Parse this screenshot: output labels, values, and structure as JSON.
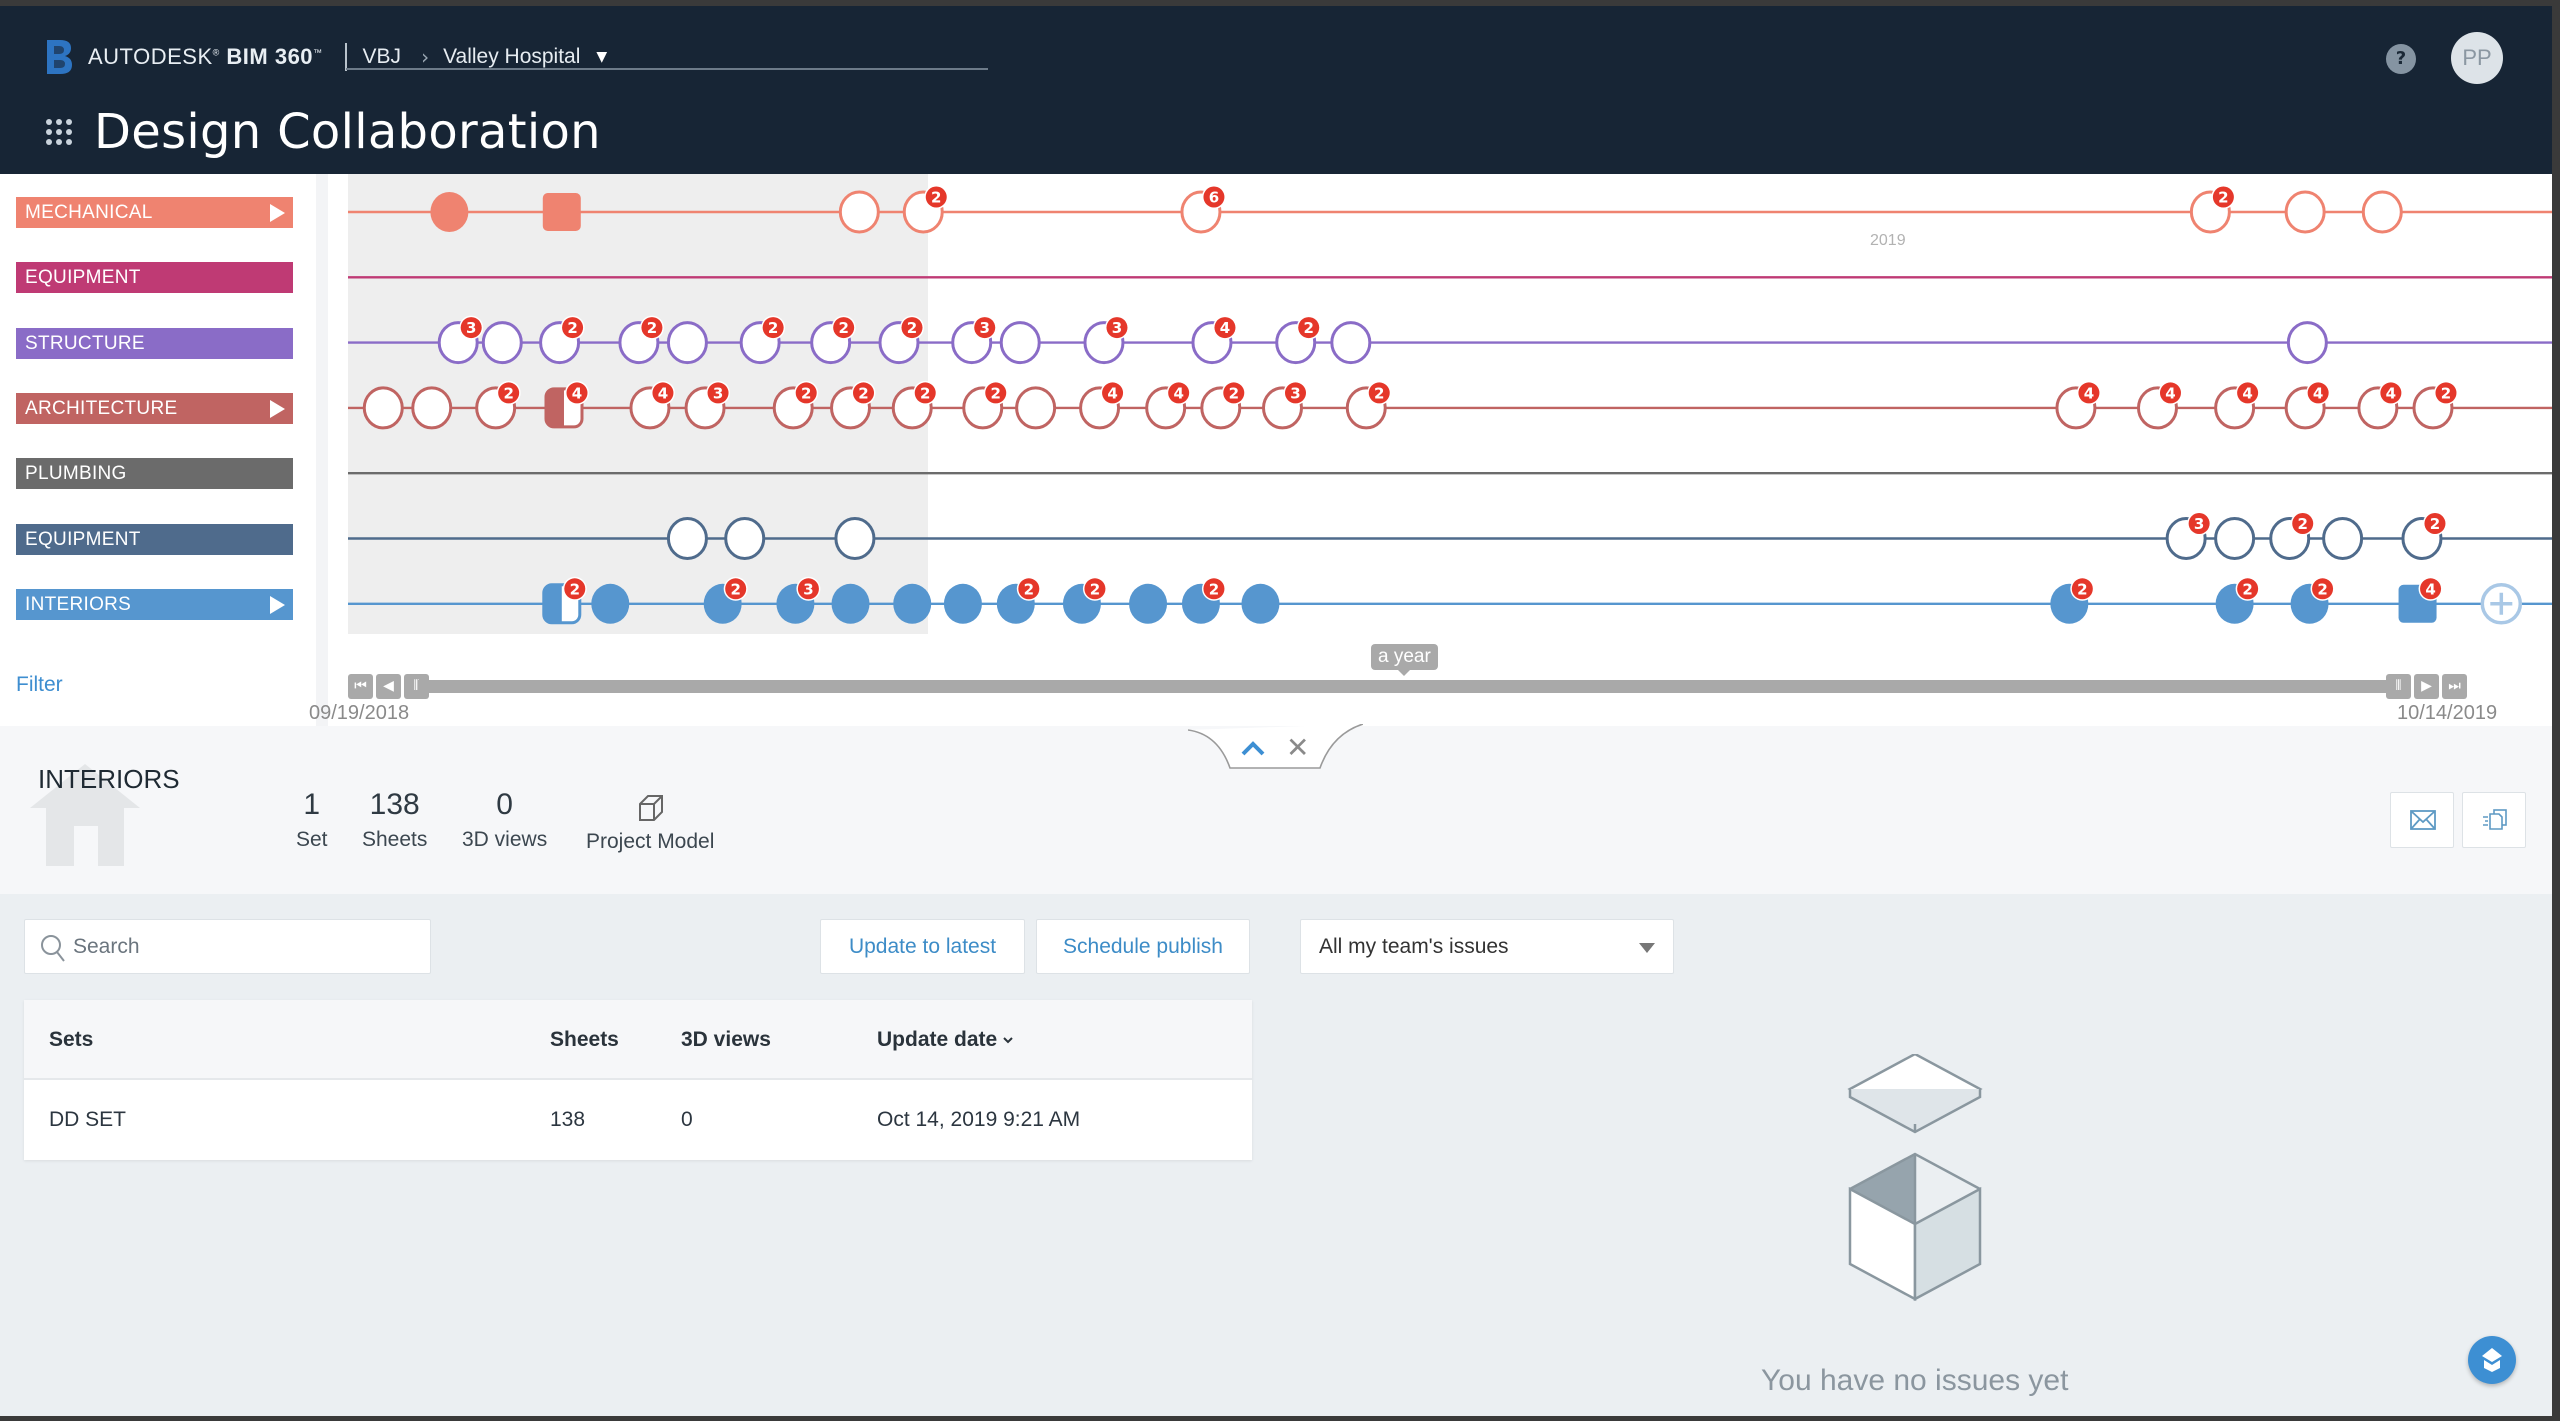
{
  "header": {
    "brand_prefix": "AUTODESK",
    "brand_product": "BIM 360",
    "account": "VBJ",
    "project": "Valley Hospital",
    "page_title": "Design Collaboration",
    "help_label": "?",
    "avatar_initials": "PP"
  },
  "timeline": {
    "year_marker": "2019",
    "range_label": "a year",
    "start_date": "09/19/2018",
    "end_date": "10/14/2019",
    "filter_label": "Filter",
    "current_window_end": 0.263,
    "lanes": [
      {
        "label": "MECHANICAL",
        "color": "#ef8370",
        "expandable": true,
        "nodes": [
          {
            "t": 0.046,
            "kind": "filled"
          },
          {
            "t": 0.097,
            "kind": "filled-square"
          },
          {
            "t": 0.232,
            "kind": "open"
          },
          {
            "t": 0.261,
            "kind": "open",
            "badge": 2
          },
          {
            "t": 0.387,
            "kind": "open",
            "badge": 6
          },
          {
            "t": 0.845,
            "kind": "open",
            "badge": 2
          },
          {
            "t": 0.888,
            "kind": "open"
          },
          {
            "t": 0.923,
            "kind": "open"
          }
        ]
      },
      {
        "label": "EQUIPMENT",
        "color": "#bf3a74",
        "expandable": false,
        "nodes": []
      },
      {
        "label": "STRUCTURE",
        "color": "#8a6cc7",
        "expandable": false,
        "nodes": [
          {
            "t": 0.05,
            "kind": "open",
            "badge": 3
          },
          {
            "t": 0.07,
            "kind": "open"
          },
          {
            "t": 0.096,
            "kind": "open",
            "badge": 2
          },
          {
            "t": 0.132,
            "kind": "open",
            "badge": 2
          },
          {
            "t": 0.154,
            "kind": "open"
          },
          {
            "t": 0.187,
            "kind": "open",
            "badge": 2
          },
          {
            "t": 0.219,
            "kind": "open",
            "badge": 2
          },
          {
            "t": 0.25,
            "kind": "open",
            "badge": 2
          },
          {
            "t": 0.283,
            "kind": "open",
            "badge": 3
          },
          {
            "t": 0.305,
            "kind": "open"
          },
          {
            "t": 0.343,
            "kind": "open",
            "badge": 3
          },
          {
            "t": 0.392,
            "kind": "open",
            "badge": 4
          },
          {
            "t": 0.43,
            "kind": "open",
            "badge": 2
          },
          {
            "t": 0.455,
            "kind": "open"
          },
          {
            "t": 0.889,
            "kind": "open"
          }
        ]
      },
      {
        "label": "ARCHITECTURE",
        "color": "#c06462",
        "expandable": true,
        "nodes": [
          {
            "t": 0.016,
            "kind": "open"
          },
          {
            "t": 0.038,
            "kind": "open"
          },
          {
            "t": 0.067,
            "kind": "open",
            "badge": 2
          },
          {
            "t": 0.098,
            "kind": "half",
            "badge": 4
          },
          {
            "t": 0.137,
            "kind": "open",
            "badge": 4
          },
          {
            "t": 0.162,
            "kind": "open",
            "badge": 3
          },
          {
            "t": 0.202,
            "kind": "open",
            "badge": 2
          },
          {
            "t": 0.228,
            "kind": "open",
            "badge": 2
          },
          {
            "t": 0.256,
            "kind": "open",
            "badge": 2
          },
          {
            "t": 0.288,
            "kind": "open",
            "badge": 2
          },
          {
            "t": 0.312,
            "kind": "open"
          },
          {
            "t": 0.341,
            "kind": "open",
            "badge": 4
          },
          {
            "t": 0.371,
            "kind": "open",
            "badge": 4
          },
          {
            "t": 0.396,
            "kind": "open",
            "badge": 2
          },
          {
            "t": 0.424,
            "kind": "open",
            "badge": 3
          },
          {
            "t": 0.462,
            "kind": "open",
            "badge": 2
          },
          {
            "t": 0.784,
            "kind": "open",
            "badge": 4
          },
          {
            "t": 0.821,
            "kind": "open",
            "badge": 4
          },
          {
            "t": 0.856,
            "kind": "open",
            "badge": 4
          },
          {
            "t": 0.888,
            "kind": "open",
            "badge": 4
          },
          {
            "t": 0.921,
            "kind": "open",
            "badge": 4
          },
          {
            "t": 0.946,
            "kind": "open",
            "badge": 2
          }
        ]
      },
      {
        "label": "PLUMBING",
        "color": "#6b6b6b",
        "expandable": false,
        "nodes": []
      },
      {
        "label": "EQUIPMENT",
        "color": "#4f6b8c",
        "expandable": false,
        "nodes": [
          {
            "t": 0.154,
            "kind": "open"
          },
          {
            "t": 0.18,
            "kind": "open"
          },
          {
            "t": 0.23,
            "kind": "open"
          },
          {
            "t": 0.834,
            "kind": "open",
            "badge": 3
          },
          {
            "t": 0.856,
            "kind": "open"
          },
          {
            "t": 0.881,
            "kind": "open",
            "badge": 2
          },
          {
            "t": 0.905,
            "kind": "open"
          },
          {
            "t": 0.941,
            "kind": "open",
            "badge": 2
          }
        ]
      },
      {
        "label": "INTERIORS",
        "color": "#5696cf",
        "expandable": true,
        "nodes": [
          {
            "t": 0.097,
            "kind": "half",
            "badge": 2
          },
          {
            "t": 0.119,
            "kind": "filled"
          },
          {
            "t": 0.17,
            "kind": "filled",
            "badge": 2
          },
          {
            "t": 0.203,
            "kind": "filled",
            "badge": 3
          },
          {
            "t": 0.228,
            "kind": "filled"
          },
          {
            "t": 0.256,
            "kind": "filled"
          },
          {
            "t": 0.279,
            "kind": "filled"
          },
          {
            "t": 0.303,
            "kind": "filled",
            "badge": 2
          },
          {
            "t": 0.333,
            "kind": "filled",
            "badge": 2
          },
          {
            "t": 0.363,
            "kind": "filled"
          },
          {
            "t": 0.387,
            "kind": "filled",
            "badge": 2
          },
          {
            "t": 0.414,
            "kind": "filled"
          },
          {
            "t": 0.781,
            "kind": "filled",
            "badge": 2
          },
          {
            "t": 0.856,
            "kind": "filled",
            "badge": 2
          },
          {
            "t": 0.89,
            "kind": "filled",
            "badge": 2
          },
          {
            "t": 0.939,
            "kind": "filled-square",
            "badge": 4
          },
          {
            "t": 0.977,
            "kind": "add"
          }
        ]
      }
    ]
  },
  "detail": {
    "title": "INTERIORS",
    "stats": [
      {
        "value": "1",
        "label": "Set"
      },
      {
        "value": "138",
        "label": "Sheets"
      },
      {
        "value": "0",
        "label": "3D views"
      },
      {
        "value": "",
        "label": "Project Model"
      }
    ]
  },
  "toolbar": {
    "search_placeholder": "Search",
    "update_label": "Update to latest",
    "schedule_label": "Schedule publish",
    "issues_filter": "All my team's issues"
  },
  "table": {
    "columns": [
      "Sets",
      "Sheets",
      "3D views",
      "Update date"
    ],
    "rows": [
      {
        "set": "DD SET",
        "sheets": "138",
        "views": "0",
        "date": "Oct 14, 2019 9:21 AM"
      }
    ]
  },
  "issues": {
    "empty_text": "You have no issues yet"
  },
  "colors": {
    "header_bg": "#172535",
    "accent": "#3d8cc7",
    "badge": "#e5372a"
  }
}
